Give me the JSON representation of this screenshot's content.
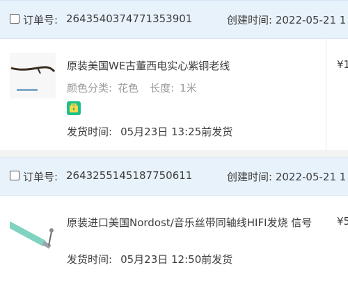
{
  "orders": [
    {
      "checkbox_label": "订单号:",
      "order_number": "2643540374771353901",
      "created_label": "创建时间:",
      "created_date": "2022-05-21 1",
      "item": {
        "title": "原装美国WE古董西电实心紫铜老线",
        "color_label": "颜色分类:",
        "color_value": "花色",
        "length_label": "长度:",
        "length_value": "1米",
        "ship_label": "发货时间:",
        "ship_value": "05月23日 13:25前发货",
        "price": "¥1",
        "badge_icon": "bag-icon"
      }
    },
    {
      "checkbox_label": "订单号:",
      "order_number": "2643255145187750611",
      "created_label": "创建时间:",
      "created_date": "2022-05-21 1",
      "item": {
        "title": "原装进口美国Nordost/音乐丝带同轴线HIFI发烧 信号",
        "ship_label": "发货时间:",
        "ship_value": "05月23日 12:50前发货",
        "price": "¥5"
      }
    }
  ]
}
